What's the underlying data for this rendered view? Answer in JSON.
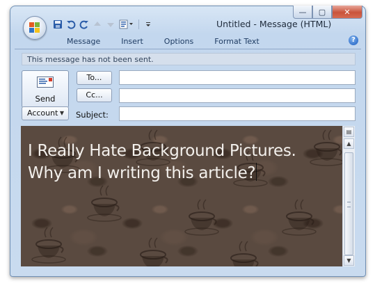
{
  "window": {
    "title": "Untitled - Message (HTML)",
    "controls": {
      "minimize": "—",
      "maximize": "▢",
      "close": "✕"
    }
  },
  "quick_access": {
    "icons": [
      "save-icon",
      "undo-icon",
      "redo-icon",
      "previous-item-icon",
      "next-item-icon",
      "format-dropdown-icon",
      "customize-icon"
    ]
  },
  "ribbon": {
    "tabs": [
      "Message",
      "Insert",
      "Options",
      "Format Text"
    ],
    "help": "?"
  },
  "infobar": {
    "text": "This message has not been sent."
  },
  "compose": {
    "send_label": "Send",
    "to_label": "To...",
    "cc_label": "Cc...",
    "account_label": "Account",
    "subject_label": "Subject:",
    "to_value": "",
    "cc_value": "",
    "subject_value": ""
  },
  "body": {
    "line1": "I Really Hate Background Pictures.",
    "line2": "Why am I writing this article?"
  },
  "colors": {
    "accent": "#2a5ca8",
    "window_frame": "#c3d7ee",
    "close_button": "#c9533b",
    "body_background": "#5a4a40",
    "body_text": "#f3f0ec"
  }
}
